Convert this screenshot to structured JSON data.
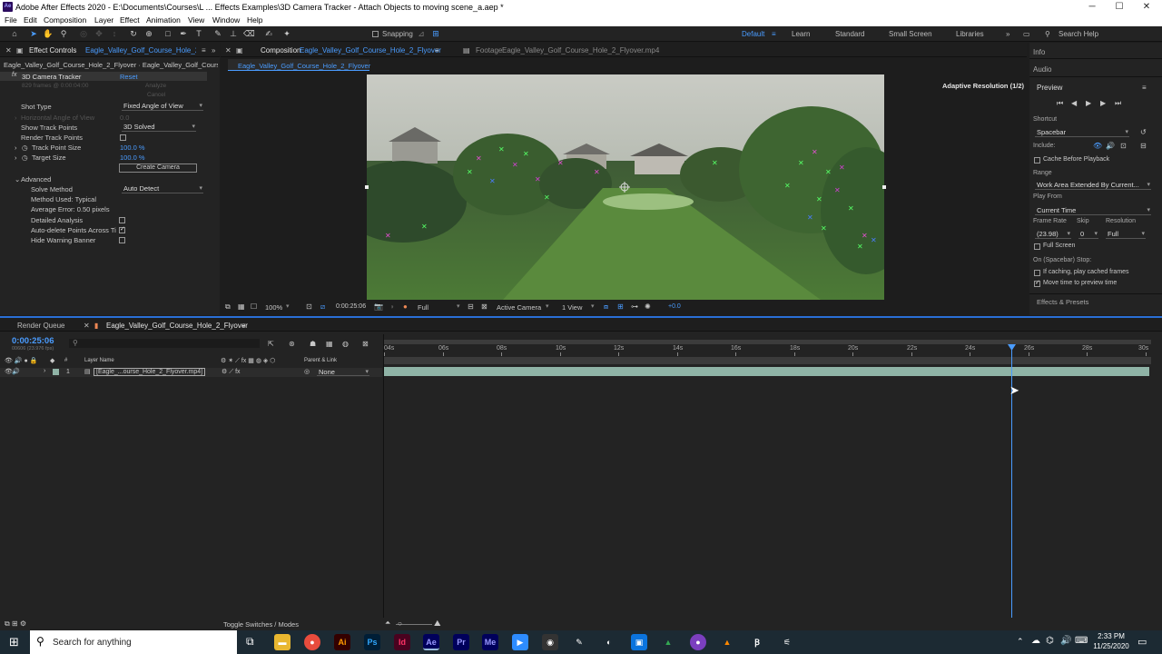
{
  "window": {
    "title": "Adobe After Effects 2020 - E:\\Documents\\Courses\\L ... Effects Examples\\3D Camera Tracker - Attach Objects to moving scene_a.aep *",
    "minimize": "─",
    "maximize": "☐",
    "close": "✕"
  },
  "menu": [
    "File",
    "Edit",
    "Composition",
    "Layer",
    "Effect",
    "Animation",
    "View",
    "Window",
    "Help"
  ],
  "toolbar": {
    "snapping": "Snapping",
    "workspaces": [
      "Default",
      "Learn",
      "Standard",
      "Small Screen",
      "Libraries"
    ],
    "search_placeholder": "Search Help"
  },
  "effect_controls": {
    "tab_label": "Effect Controls",
    "tab_layer": "Eagle_Valley_Golf_Course_Hole_2_F",
    "header": "Eagle_Valley_Golf_Course_Hole_2_Flyover · Eagle_Valley_Golf_Course",
    "effect_name": "3D Camera Tracker",
    "reset": "Reset",
    "status_line": "829 frames @ 0:00:04:00",
    "analyze": "Analyze",
    "cancel": "Cancel",
    "shot_type_label": "Shot Type",
    "shot_type_value": "Fixed Angle of View",
    "horizontal_aov_label": "Horizontal Angle of View",
    "horizontal_aov_value": "0.0",
    "show_track_points_label": "Show Track Points",
    "show_track_points_value": "3D Solved",
    "render_track_points_label": "Render Track Points",
    "track_point_size_label": "Track Point Size",
    "track_point_size_value": "100.0 %",
    "target_size_label": "Target Size",
    "target_size_value": "100.0 %",
    "create_camera": "Create Camera",
    "advanced_label": "Advanced",
    "solve_method_label": "Solve Method",
    "solve_method_value": "Auto Detect",
    "method_used": "Method Used: Typical",
    "average_error": "Average Error: 0.50 pixels",
    "detailed_analysis": "Detailed Analysis",
    "auto_delete": "Auto-delete Points Across Ti",
    "hide_warning": "Hide Warning Banner"
  },
  "composition": {
    "tab_label": "Composition",
    "tab_name": "Eagle_Valley_Golf_Course_Hole_2_Flyover",
    "footage_label": "Footage",
    "footage_name": "Eagle_Valley_Golf_Course_Hole_2_Flyover.mp4",
    "breadcrumb": "Eagle_Valley_Golf_Course_Hole_2_Flyover",
    "adaptive_resolution": "Adaptive Resolution (1/2)",
    "zoom": "100%",
    "timecode": "0:00:25:06",
    "resolution": "Full",
    "camera": "Active Camera",
    "views": "1 View",
    "exposure": "+0.0"
  },
  "right_panel": {
    "info": "Info",
    "audio": "Audio",
    "preview": "Preview",
    "shortcut_label": "Shortcut",
    "shortcut_value": "Spacebar",
    "include_label": "Include:",
    "cache_before_playback": "Cache Before Playback",
    "range_label": "Range",
    "range_value": "Work Area Extended By Current...",
    "play_from_label": "Play From",
    "play_from_value": "Current Time",
    "frame_rate_label": "Frame Rate",
    "skip_label": "Skip",
    "resolution_label": "Resolution",
    "frame_rate_value": "(23.98)",
    "skip_value": "0",
    "resolution_value": "Full",
    "full_screen": "Full Screen",
    "on_stop_label": "On (Spacebar) Stop:",
    "if_caching": "If caching, play cached frames",
    "move_time": "Move time to preview time",
    "effects_presets": "Effects & Presets"
  },
  "timeline": {
    "render_queue": "Render Queue",
    "comp_tab": "Eagle_Valley_Golf_Course_Hole_2_Flyover",
    "current_time": "0:00:25:06",
    "frame_info": "00606 (23.976 fps)",
    "col_number": "#",
    "col_layer_name": "Layer Name",
    "col_parent": "Parent & Link",
    "layer_index": "1",
    "layer_name": "[Eagle_...ourse_Hole_2_Flyover.mp4]",
    "layer_parent": "None",
    "ruler": [
      "04s",
      "06s",
      "08s",
      "10s",
      "12s",
      "14s",
      "16s",
      "18s",
      "20s",
      "22s",
      "24s",
      "26s",
      "28s",
      "30s"
    ],
    "toggle_modes": "Toggle Switches / Modes",
    "playhead_fraction": 0.818
  },
  "taskbar": {
    "search_placeholder": "Search for anything",
    "time": "2:33 PM",
    "date": "11/25/2020",
    "apps": [
      "Ai",
      "Ps",
      "Id",
      "Ae",
      "Pr",
      "Me"
    ]
  },
  "colors": {
    "accent_blue": "#4a9cff",
    "layer_bar": "#8fb3a6",
    "panel_bg": "#232323"
  }
}
